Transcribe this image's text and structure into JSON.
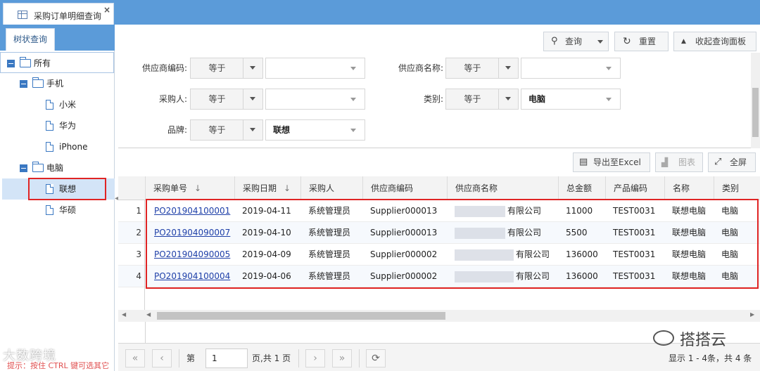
{
  "tab": {
    "title": "采购订单明细查询",
    "close": "×"
  },
  "sidebar": {
    "tab_label": "树状查询",
    "tree": {
      "root": "所有",
      "groups": [
        {
          "label": "手机",
          "items": [
            "小米",
            "华为",
            "iPhone"
          ]
        },
        {
          "label": "电脑",
          "items": [
            "联想",
            "华硕"
          ]
        }
      ],
      "selected": "联想"
    },
    "collapse_arrow": "◂"
  },
  "actions": {
    "query": "查询",
    "reset": "重置",
    "collapse_panel": "收起查询面板"
  },
  "filters": [
    {
      "label": "供应商编码:",
      "operator": "等于",
      "value": ""
    },
    {
      "label": "供应商名称:",
      "operator": "等于",
      "value": ""
    },
    {
      "label": "采购人:",
      "operator": "等于",
      "value": ""
    },
    {
      "label": "类别:",
      "operator": "等于",
      "value": "电脑"
    },
    {
      "label": "品牌:",
      "operator": "等于",
      "value": "联想"
    }
  ],
  "toolbar": {
    "export": "导出至Excel",
    "chart": "图表",
    "fullscreen": "全屏"
  },
  "grid": {
    "columns": [
      "采购单号",
      "采购日期",
      "采购人",
      "供应商编码",
      "供应商名称",
      "总金额",
      "产品编码",
      "名称",
      "类别"
    ],
    "sort_mark": "↓",
    "rows": [
      {
        "num": "1",
        "order": "PO201904100001",
        "date": "2019-04-11",
        "buyer": "系统管理员",
        "supplier_code": "Supplier000013",
        "supplier_name": "有限公司",
        "amount": "11000",
        "product_code": "TEST0031",
        "name": "联想电脑",
        "category": "电脑"
      },
      {
        "num": "2",
        "order": "PO201904090007",
        "date": "2019-04-10",
        "buyer": "系统管理员",
        "supplier_code": "Supplier000013",
        "supplier_name": "有限公司",
        "amount": "5500",
        "product_code": "TEST0031",
        "name": "联想电脑",
        "category": "电脑"
      },
      {
        "num": "3",
        "order": "PO201904090005",
        "date": "2019-04-09",
        "buyer": "系统管理员",
        "supplier_code": "Supplier000002",
        "supplier_name": "有限公司",
        "amount": "136000",
        "product_code": "TEST0031",
        "name": "联想电脑",
        "category": "电脑"
      },
      {
        "num": "4",
        "order": "PO201904100004",
        "date": "2019-04-06",
        "buyer": "系统管理员",
        "supplier_code": "Supplier000002",
        "supplier_name": "有限公司",
        "amount": "136000",
        "product_code": "TEST0031",
        "name": "联想电脑",
        "category": "电脑"
      }
    ]
  },
  "pager": {
    "first": "«",
    "prev": "‹",
    "next": "›",
    "last": "»",
    "page_prefix": "第",
    "page_value": "1",
    "page_suffix": "页,共 1 页",
    "refresh": "⟳",
    "summary": "显示 1 - 4条，共 4 条"
  },
  "hint": "提示：按住 CTRL 键可选其它",
  "watermarks": {
    "left": "大数跨境",
    "right": "搭搭云"
  },
  "colors": {
    "header_blue": "#5b9bd9",
    "highlight_red": "#e02424",
    "link_blue": "#1e3fa8"
  }
}
